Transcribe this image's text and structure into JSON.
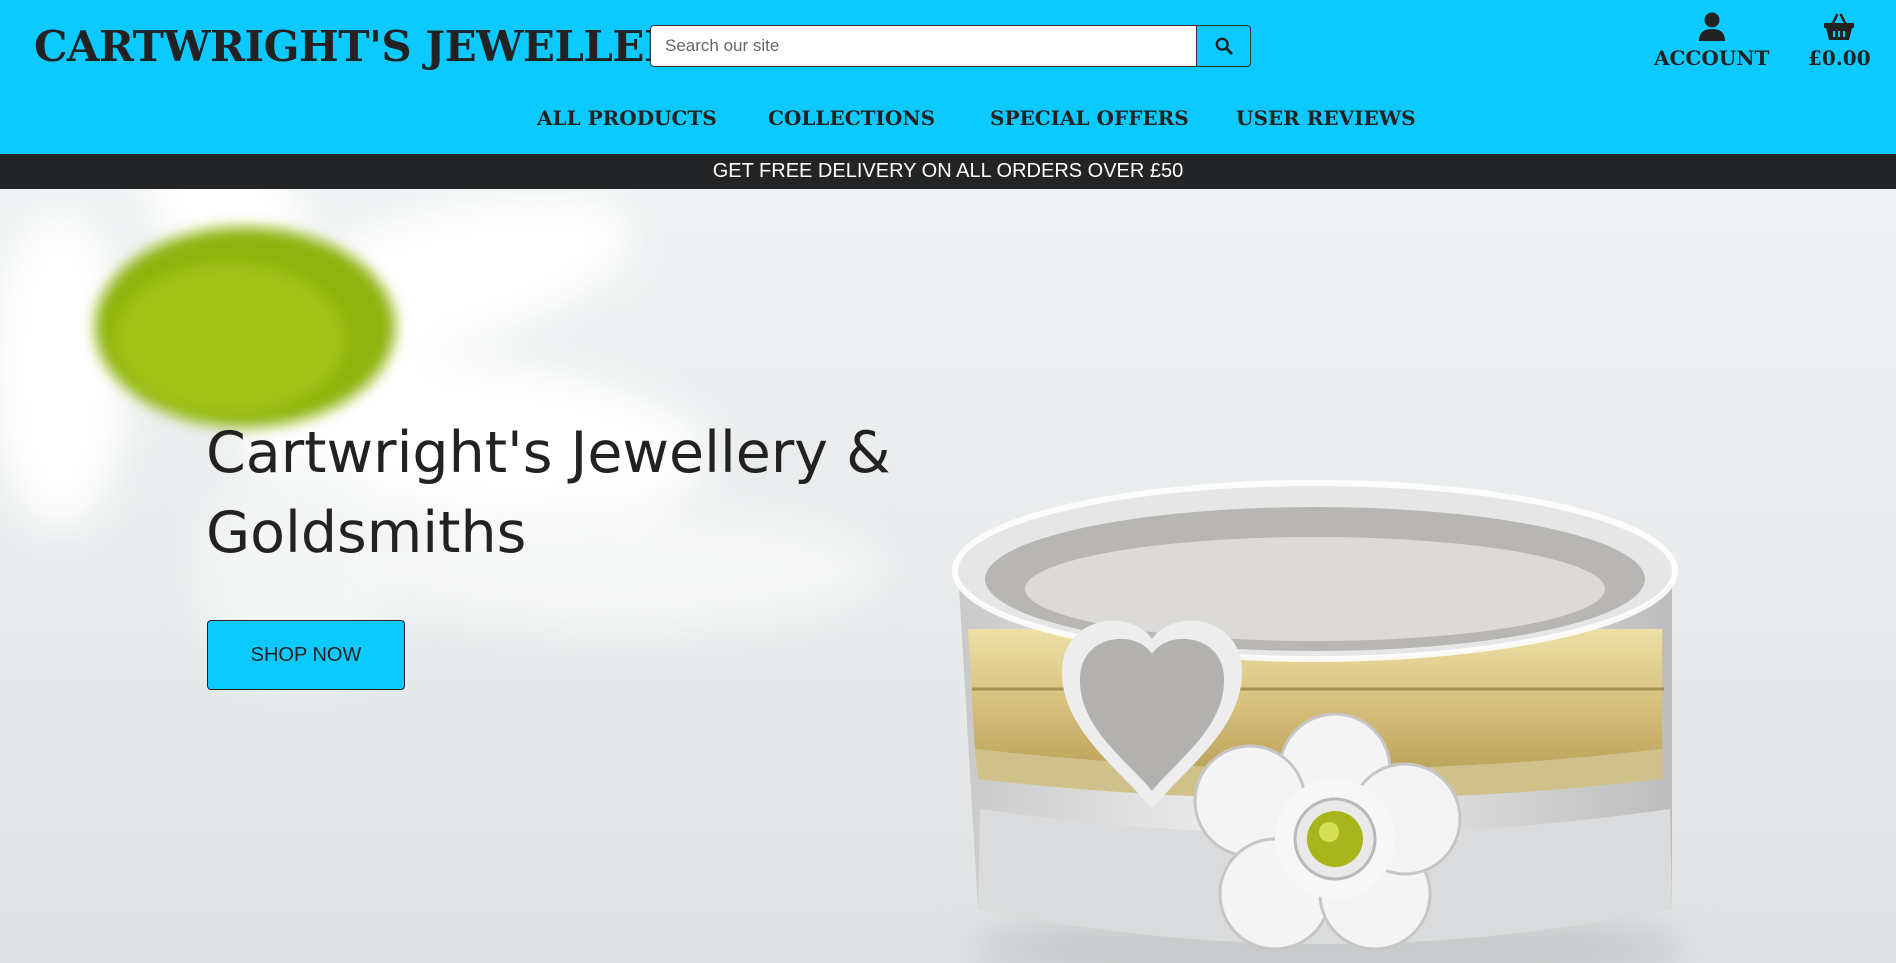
{
  "header": {
    "logo": "CARTWRIGHT'S JEWELLERY",
    "search": {
      "placeholder": "Search our site",
      "button_icon": "search-icon"
    },
    "account": {
      "icon": "user-icon",
      "label": "ACCOUNT"
    },
    "basket": {
      "icon": "basket-icon",
      "label": "£0.00"
    },
    "nav": [
      "ALL PRODUCTS",
      "COLLECTIONS",
      "SPECIAL OFFERS",
      "USER REVIEWS"
    ]
  },
  "banner": {
    "text": "GET FREE DELIVERY ON ALL ORDERS OVER £50"
  },
  "hero": {
    "heading_line1": "Cartwright's Jewellery &",
    "heading_line2": "Goldsmiths",
    "cta": "SHOP NOW"
  },
  "colors": {
    "brand": "#0ccaff",
    "banner_bg": "#222426",
    "text": "#222222"
  }
}
